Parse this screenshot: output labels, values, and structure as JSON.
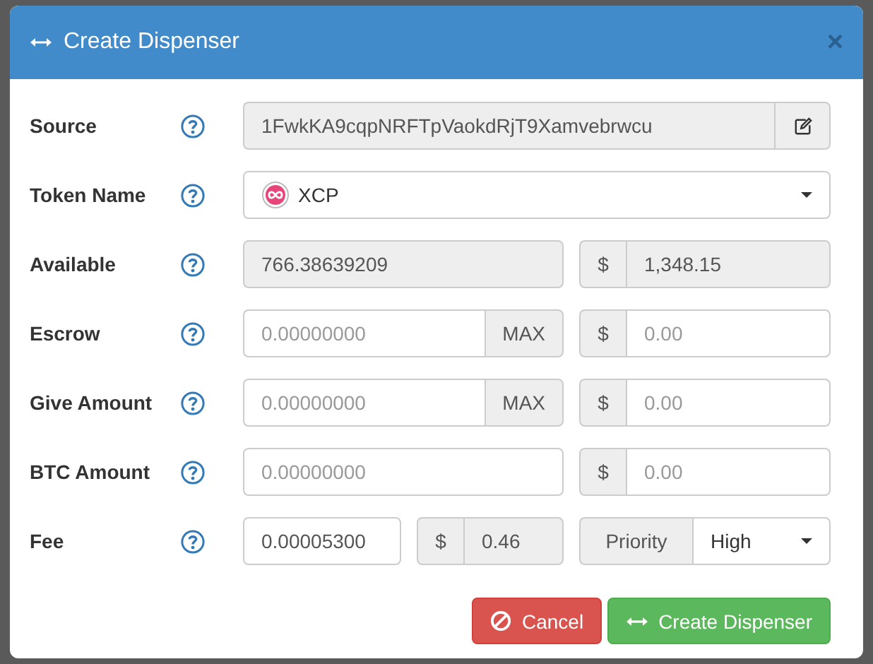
{
  "dialog": {
    "title": "Create Dispenser",
    "close": "×"
  },
  "rows": [
    {
      "label": "Source",
      "kind": "address",
      "value": "1FwkKA9cqpNRFTpVaokdRjT9Xamvebrwcu",
      "readonly": true
    },
    {
      "label": "Token Name",
      "kind": "token",
      "value": "XCP"
    },
    {
      "label": "Available",
      "kind": "amount",
      "amount": {
        "value": "766.38639209",
        "readonly": true
      },
      "usd": {
        "addon": "$",
        "value": "1,348.15",
        "readonly": true
      }
    },
    {
      "label": "Escrow",
      "kind": "amount",
      "amount": {
        "placeholder": "0.00000000",
        "readonly": false,
        "button": "MAX"
      },
      "usd": {
        "addon": "$",
        "placeholder": "0.00",
        "readonly": false
      }
    },
    {
      "label": "Give Amount",
      "kind": "amount",
      "amount": {
        "placeholder": "0.00000000",
        "readonly": false,
        "button": "MAX"
      },
      "usd": {
        "addon": "$",
        "placeholder": "0.00",
        "readonly": false
      }
    },
    {
      "label": "BTC Amount",
      "kind": "amount",
      "amount": {
        "placeholder": "0.00000000",
        "readonly": false
      },
      "usd": {
        "addon": "$",
        "placeholder": "0.00",
        "readonly": false
      }
    },
    {
      "label": "Fee",
      "kind": "fee",
      "fee": {
        "value": "0.00005300",
        "readonly": false
      },
      "usd": {
        "addon": "$",
        "value": "0.46",
        "readonly": true
      },
      "priority": {
        "addon": "Priority",
        "value": "High"
      }
    }
  ],
  "buttons": [
    {
      "label": "Cancel",
      "kind": "cancel"
    },
    {
      "label": "Create Dispenser",
      "kind": "primary"
    }
  ]
}
